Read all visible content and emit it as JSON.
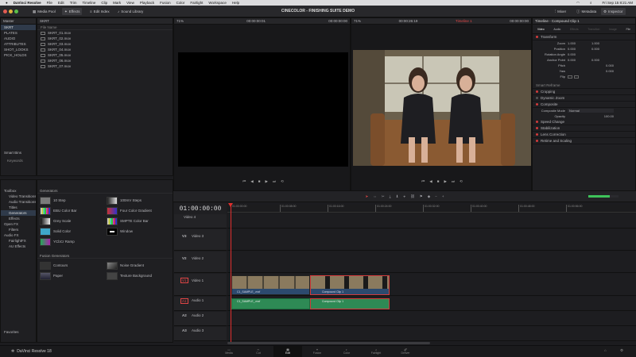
{
  "menubar": {
    "app": "DaVinci Resolve",
    "items": [
      "File",
      "Edit",
      "Trim",
      "Timeline",
      "Clip",
      "Mark",
      "View",
      "Playback",
      "Fusion",
      "Color",
      "Fairlight",
      "Workspace",
      "Help"
    ],
    "clock": "Fri Sep 15 8:21 AM"
  },
  "titlebar": {
    "title": "CINECOLOR - FINISHING SUITE DEMO",
    "left_tabs": [
      "Media Pool",
      "Effects",
      "Edit Index",
      "Sound Library"
    ],
    "right_tabs": [
      "Mixer",
      "Metadata",
      "Inspector"
    ]
  },
  "bins": {
    "header": "Master",
    "items": [
      "SKRT",
      "PLATES",
      "AUDIO",
      "ATTRIBUTES",
      "SHOT_LOOKS",
      "PICK_HOLDS"
    ],
    "smart_bins": "Smart Bins",
    "keywords": "Keywords"
  },
  "media_pool": {
    "bin_name": "SKRT",
    "column_header": "File Name",
    "files": [
      "SKRT_01.mov",
      "SKRT_02.mov",
      "SKRT_03.mov",
      "SKRT_04.mov",
      "SKRT_05.mov",
      "SKRT_06.mov",
      "SKRT_07.mov"
    ]
  },
  "effects_tree": {
    "items": [
      "Toolbox",
      "Video Transitions",
      "Audio Transitions",
      "Titles",
      "Generators",
      "Effects",
      "Open FX",
      "Filters",
      "Audio FX",
      "FairlightFX",
      "AU Effects"
    ],
    "footer": "Favorites"
  },
  "generators": {
    "header": "Generators",
    "items": [
      {
        "name": "10 Step",
        "swatch": "#7a7a7a"
      },
      {
        "name": "100mV Steps",
        "swatch": "#9a9a9a"
      },
      {
        "name": "EBU Color Bar",
        "swatch": "#c8b34a"
      },
      {
        "name": "Four Color Gradient",
        "swatch": "#8a4fa8"
      },
      {
        "name": "Grey Scale",
        "swatch": "#888888"
      },
      {
        "name": "SMPTE Color Bar",
        "swatch": "#4a8ac8"
      },
      {
        "name": "Solid Color",
        "swatch": "#3fa7c9"
      },
      {
        "name": "Window",
        "swatch": "#ffffff"
      },
      {
        "name": "YCbCr Ramp",
        "swatch": "#4aa85a"
      }
    ],
    "fusion_header": "Fusion Generators",
    "fusion_items": [
      "Contours",
      "Noise Gradient",
      "Paper",
      "Texture Background"
    ]
  },
  "source_viewer": {
    "zoom": "71%",
    "timecode_in": "00:00:00:01",
    "timecode": "00:00:00:00"
  },
  "timeline_viewer": {
    "zoom": "71%",
    "timecode_in": "00:00:26:19",
    "timecode": "00:00:00:00",
    "timeline_name": "Timeline 1"
  },
  "inspector": {
    "title": "Timeline - Compound Clip 1",
    "tabs": [
      "Video",
      "Audio",
      "Effects",
      "Transition",
      "Image",
      "File"
    ],
    "transform_label": "Transform",
    "zoom_label": "Zoom",
    "zoom_x": "1.000",
    "zoom_y": "1.000",
    "position_label": "Position",
    "pos_x": "0.000",
    "pos_y": "0.000",
    "rotation_label": "Rotation Angle",
    "rotation": "0.000",
    "anchor_label": "Anchor Point",
    "anchor_x": "0.000",
    "anchor_y": "0.000",
    "pitch_label": "Pitch",
    "pitch": "0.000",
    "yaw_label": "Yaw",
    "yaw": "0.000",
    "flip_label": "Flip",
    "smart_reframe": "Smart Reframe",
    "cropping": "Cropping",
    "dynamic_zoom": "Dynamic Zoom",
    "composite": "Composite",
    "composite_mode_label": "Composite Mode",
    "composite_mode": "Normal",
    "opacity_label": "Opacity",
    "opacity": "100.00",
    "sections": [
      "Speed Change",
      "Stabilization",
      "Lens Correction",
      "Retime and Scaling"
    ]
  },
  "timeline": {
    "timecode": "01:00:00:00",
    "ruler": [
      "01:00:00:00",
      "01:00:08:00",
      "01:00:16:00",
      "01:00:24:00",
      "01:00:32:00",
      "01:00:40:00",
      "01:00:48:00",
      "01:00:56:00"
    ],
    "tracks": {
      "v4": "Video 4",
      "v3": "Video 3",
      "v2": "Video 2",
      "v1": "Video 1",
      "a1": "Audio 1",
      "a2": "Audio 2",
      "a3": "Audio 3",
      "v3_id": "V3",
      "v2_id": "V2",
      "v1_id": "V1",
      "a1_id": "A1",
      "a2_id": "A2",
      "a3_id": "A3"
    },
    "clip_a_video": "C1_SAMPLE_.mxf",
    "clip_b_video": "Compound Clip 1",
    "clip_a_audio": "C1_SAMPLE_.mxf",
    "clip_b_audio": "Compound Clip 1"
  },
  "pages": {
    "brand": "DaVinci Resolve 18",
    "items": [
      "Media",
      "Cut",
      "Edit",
      "Fusion",
      "Color",
      "Fairlight",
      "Deliver"
    ],
    "active": "Edit"
  },
  "colors": {
    "accent": "#d23b3b",
    "playhead": "#e0302f",
    "audio_clip": "#2e8a55",
    "selection": "#2f3a4a"
  }
}
